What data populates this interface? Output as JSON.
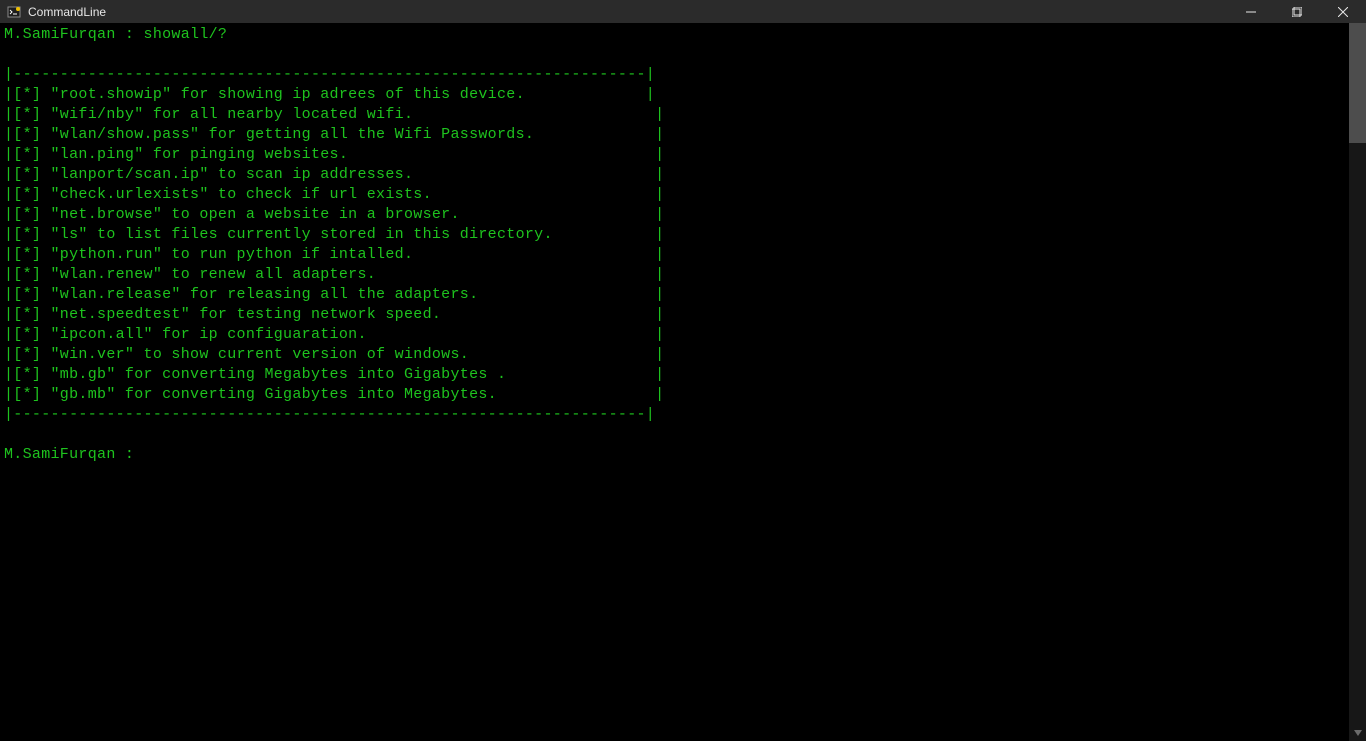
{
  "window": {
    "title": "CommandLine"
  },
  "terminal": {
    "prompt_user": "M.SamiFurqan",
    "command": "showall/?",
    "line_prompt": "M.SamiFurqan : showall/?",
    "rule": "|--------------------------------------------------------------------|",
    "entries": [
      {
        "text": "|[*] \"root.showip\" for showing ip adrees of this device.             |"
      },
      {
        "text": "|[*] \"wifi/nby\" for all nearby located wifi.                          |"
      },
      {
        "text": "|[*] \"wlan/show.pass\" for getting all the Wifi Passwords.             |"
      },
      {
        "text": "|[*] \"lan.ping\" for pinging websites.                                 |"
      },
      {
        "text": "|[*] \"lanport/scan.ip\" to scan ip addresses.                          |"
      },
      {
        "text": "|[*] \"check.urlexists\" to check if url exists.                        |"
      },
      {
        "text": "|[*] \"net.browse\" to open a website in a browser.                     |"
      },
      {
        "text": "|[*] \"ls\" to list files currently stored in this directory.           |"
      },
      {
        "text": "|[*] \"python.run\" to run python if intalled.                          |"
      },
      {
        "text": "|[*] \"wlan.renew\" to renew all adapters.                              |"
      },
      {
        "text": "|[*] \"wlan.release\" for releasing all the adapters.                   |"
      },
      {
        "text": "|[*] \"net.speedtest\" for testing network speed.                       |"
      },
      {
        "text": "|[*] \"ipcon.all\" for ip configuaration.                               |"
      },
      {
        "text": "|[*] \"win.ver\" to show current version of windows.                    |"
      },
      {
        "text": "|[*] \"mb.gb\" for converting Megabytes into Gigabytes .                |"
      },
      {
        "text": "|[*] \"gb.mb\" for converting Gigabytes into Megabytes.                 |"
      }
    ],
    "prompt_next": "M.SamiFurqan : "
  }
}
